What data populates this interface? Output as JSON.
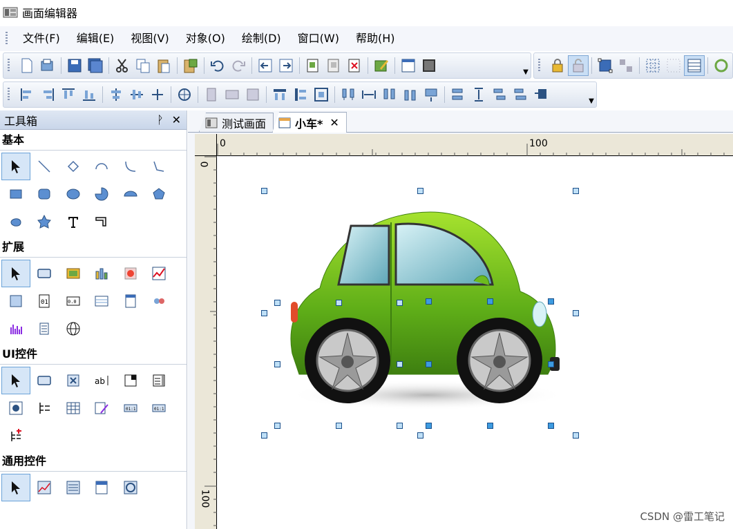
{
  "window": {
    "title": "画面编辑器"
  },
  "menu": [
    "文件(F)",
    "编辑(E)",
    "视图(V)",
    "对象(O)",
    "绘制(D)",
    "窗口(W)",
    "帮助(H)"
  ],
  "toolbox": {
    "title": "工具箱",
    "pin_icon": "pin-icon",
    "close_icon": "close-icon",
    "sections": [
      "基本",
      "扩展",
      "UI控件",
      "通用控件"
    ]
  },
  "tabs": [
    {
      "label": "测试画面",
      "active": false
    },
    {
      "label": "小车*",
      "active": true
    }
  ],
  "ruler": {
    "h_zero": "0",
    "h_hundred": "100",
    "v_zero": "0",
    "v_hundred": "100"
  },
  "watermark": "CSDN @雷工笔记",
  "colors": {
    "accent": "#3d9be0",
    "car_body": "#6dbb1e",
    "ruler_bg": "#ebe7d8"
  }
}
